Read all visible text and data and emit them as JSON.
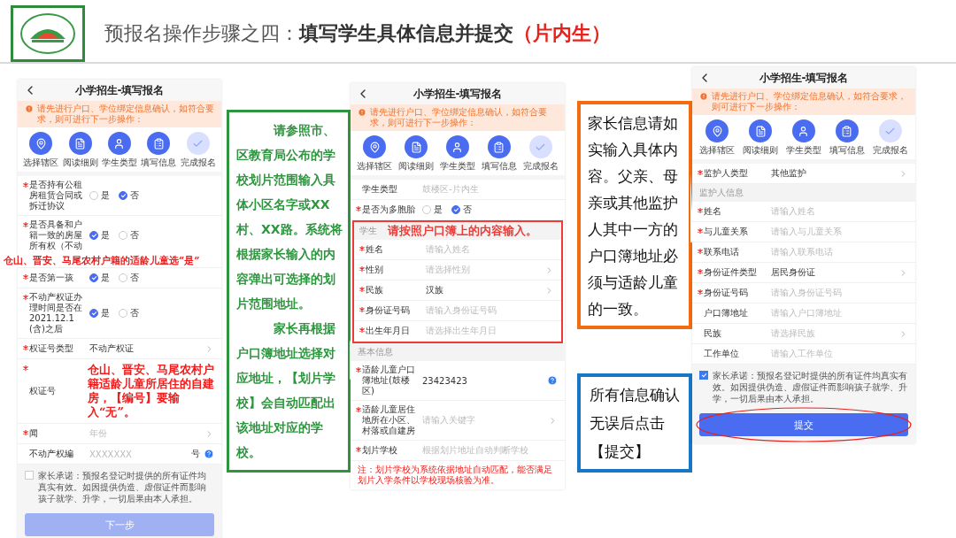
{
  "header": {
    "title_prefix": "预报名操作步骤之四：",
    "title_main": "填写学生具体信息并提交",
    "title_suffix": "（片内生）"
  },
  "phones": [
    {
      "title": "小学招生-填写报名",
      "notice": "请先进行户口、学位绑定信息确认，如符合要求，则可进行下一步操作：",
      "steps": [
        {
          "label": "选择辖区",
          "done": true
        },
        {
          "label": "阅读细则",
          "done": true
        },
        {
          "label": "学生类型",
          "done": true
        },
        {
          "label": "填写信息",
          "done": true
        },
        {
          "label": "完成报名",
          "done": false
        }
      ],
      "rows": [
        {
          "kind": "radio",
          "required": true,
          "label": "是否持有公租房租赁合同或拆迁协议",
          "options": [
            {
              "label": "是",
              "selected": false
            },
            {
              "label": "否",
              "selected": true
            }
          ]
        },
        {
          "kind": "radio",
          "required": true,
          "label": "是否具备和户籍一致的房屋所有权（不动",
          "options": [
            {
              "label": "是",
              "selected": true
            },
            {
              "label": "否",
              "selected": false
            }
          ],
          "note": "仓山、晋安、马尾农村户籍的适龄儿童选“是”"
        },
        {
          "kind": "radio",
          "required": true,
          "label": "是否第一孩",
          "options": [
            {
              "label": "是",
              "selected": true
            },
            {
              "label": "否",
              "selected": false
            }
          ]
        },
        {
          "kind": "radio",
          "required": true,
          "label": "不动产权证办理时间是否在2021.12.1(含)之后",
          "options": [
            {
              "label": "是",
              "selected": true
            },
            {
              "label": "否",
              "selected": false
            }
          ]
        },
        {
          "kind": "select",
          "required": true,
          "label": "权证号类型",
          "value": "不动产权证"
        },
        {
          "kind": "input",
          "required": true,
          "label": "权证号",
          "note": "仓山、晋安、马尾农村户籍适龄儿童所居住的自建房，【编号】要输入“无”。"
        },
        {
          "kind": "select",
          "required": true,
          "label": "闻",
          "placeholder": "年份"
        },
        {
          "kind": "input",
          "required": false,
          "label": "不动产权編",
          "placeholder": "XXXXXXX",
          "suffix": "号",
          "help": true
        }
      ],
      "agreement": {
        "checked": false,
        "text": "家长承诺：预报名登记时提供的所有证件均真实有效。如因提供伪造、虚假证件而影响孩子就学、升学，一切后果由本人承担。"
      },
      "button": {
        "label": "下一步",
        "disabled": true
      }
    },
    {
      "title": "小学招生-填写报名",
      "notice": "请先进行户口、学位绑定信息确认，如符合要求，则可进行下一步操作：",
      "steps": [
        {
          "label": "选择辖区",
          "done": true
        },
        {
          "label": "阅读细则",
          "done": true
        },
        {
          "label": "学生类型",
          "done": true
        },
        {
          "label": "填写信息",
          "done": true
        },
        {
          "label": "完成报名",
          "done": false
        }
      ],
      "rows": [
        {
          "kind": "input",
          "required": false,
          "label": "学生类型",
          "placeholder": "鼓楼区-片内生"
        },
        {
          "kind": "radio",
          "required": true,
          "label": "是否为多胞胎",
          "options": [
            {
              "label": "是",
              "selected": false
            },
            {
              "label": "否",
              "selected": true
            }
          ]
        },
        {
          "kind": "group",
          "heading": "学生",
          "note": "请按照户口簿上的内容输入。",
          "rows": [
            {
              "kind": "input",
              "required": true,
              "label": "姓名",
              "placeholder": "请输入姓名"
            },
            {
              "kind": "select",
              "required": true,
              "label": "性别",
              "placeholder": "请选择性别"
            },
            {
              "kind": "select",
              "required": true,
              "label": "民族",
              "value": "汉族"
            },
            {
              "kind": "input",
              "required": true,
              "label": "身份证号码",
              "placeholder": "请输入身份证号码"
            },
            {
              "kind": "input",
              "required": true,
              "label": "出生年月日",
              "placeholder": "请选择出生年月日"
            }
          ]
        },
        {
          "kind": "section",
          "label": "基本信息"
        },
        {
          "kind": "input",
          "required": true,
          "label": "适龄儿童户口簿地址(鼓楼区)",
          "value": "23423423",
          "help": true
        },
        {
          "kind": "select",
          "required": true,
          "label": "适龄儿童居住地所在小区、村落或自建房",
          "placeholder": "请输入关键字"
        },
        {
          "kind": "input",
          "required": true,
          "label": "划片学校",
          "placeholder": "根据划片地址自动判断学校"
        },
        {
          "kind": "warning",
          "label": "注：划片学校为系统依据地址自动匹配，能否满足划片入学条件以学校现场核验为准。"
        }
      ]
    },
    {
      "title": "小学招生-填写报名",
      "notice": "请先进行户口、学位绑定信息确认，如符合要求，则可进行下一步操作：",
      "steps": [
        {
          "label": "选择辖区",
          "done": true
        },
        {
          "label": "阅读细则",
          "done": true
        },
        {
          "label": "学生类型",
          "done": true
        },
        {
          "label": "填写信息",
          "done": true
        },
        {
          "label": "完成报名",
          "done": false
        }
      ],
      "rows": [
        {
          "kind": "select",
          "required": true,
          "label": "监护人类型",
          "value": "其他监护"
        },
        {
          "kind": "section",
          "label": "监护人信息"
        },
        {
          "kind": "input",
          "required": true,
          "label": "姓名",
          "placeholder": "请输入姓名"
        },
        {
          "kind": "input",
          "required": true,
          "label": "与儿童关系",
          "placeholder": "请输入与儿童关系"
        },
        {
          "kind": "input",
          "required": true,
          "label": "联系电话",
          "placeholder": "请输入联系电话"
        },
        {
          "kind": "select",
          "required": true,
          "label": "身份证件类型",
          "value": "居民身份证"
        },
        {
          "kind": "input",
          "required": true,
          "label": "身份证号码",
          "placeholder": "请输入身份证号码"
        },
        {
          "kind": "input",
          "required": false,
          "label": "户口簿地址",
          "placeholder": "请输入户口簿地址"
        },
        {
          "kind": "select",
          "required": false,
          "label": "民族",
          "placeholder": "请选择民族"
        },
        {
          "kind": "input",
          "required": false,
          "label": "工作单位",
          "placeholder": "请输入工作单位"
        }
      ],
      "agreement": {
        "checked": true,
        "text": "家长承诺：预报名登记时提供的所有证件均真实有效。如因提供伪造、虚假证件而影响孩子就学、升学，一切后果由本人承担。"
      },
      "button": {
        "label": "提交",
        "disabled": false
      }
    }
  ],
  "callouts": {
    "green": [
      "请参照市、区教育局公布的学校划片范围输入具体小区名字或XX村、XX路。系统将根据家长输入的内容弹出可选择的划片范围地址。",
      "家长再根据户口簿地址选择对应地址，【划片学校】会自动匹配出该地址对应的学校。"
    ],
    "parent": "家长信息请如实输入具体内容。父亲、母亲或其他监护人其中一方的户口簿地址必须与适龄儿童的一致。",
    "submit": "所有信息确认无误后点击【提交】"
  }
}
